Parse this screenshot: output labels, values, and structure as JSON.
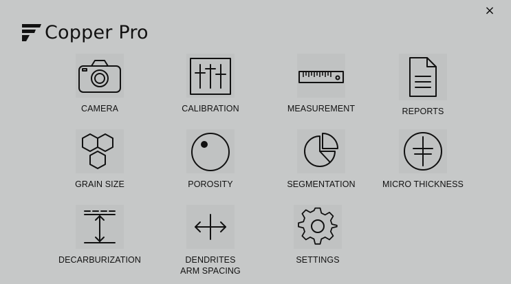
{
  "header": {
    "app_name": "Copper Pro",
    "close_label": "×"
  },
  "tiles": [
    {
      "label": "CAMERA",
      "icon": "camera-icon"
    },
    {
      "label": "CALIBRATION",
      "icon": "sliders-icon"
    },
    {
      "label": "MEASUREMENT",
      "icon": "ruler-icon"
    },
    {
      "label": "REPORTS",
      "icon": "document-icon"
    },
    {
      "label": "GRAIN SIZE",
      "icon": "hexagons-icon"
    },
    {
      "label": "POROSITY",
      "icon": "circle-dot-icon"
    },
    {
      "label": "SEGMENTATION",
      "icon": "pie-chart-icon"
    },
    {
      "label": "MICRO THICKNESS",
      "icon": "crossed-circle-icon"
    },
    {
      "label": "DECARBURIZATION",
      "icon": "vertical-dimension-icon"
    },
    {
      "label": "DENDRITES\nARM SPACING",
      "icon": "horizontal-arrows-icon"
    },
    {
      "label": "SETTINGS",
      "icon": "gear-icon"
    }
  ]
}
